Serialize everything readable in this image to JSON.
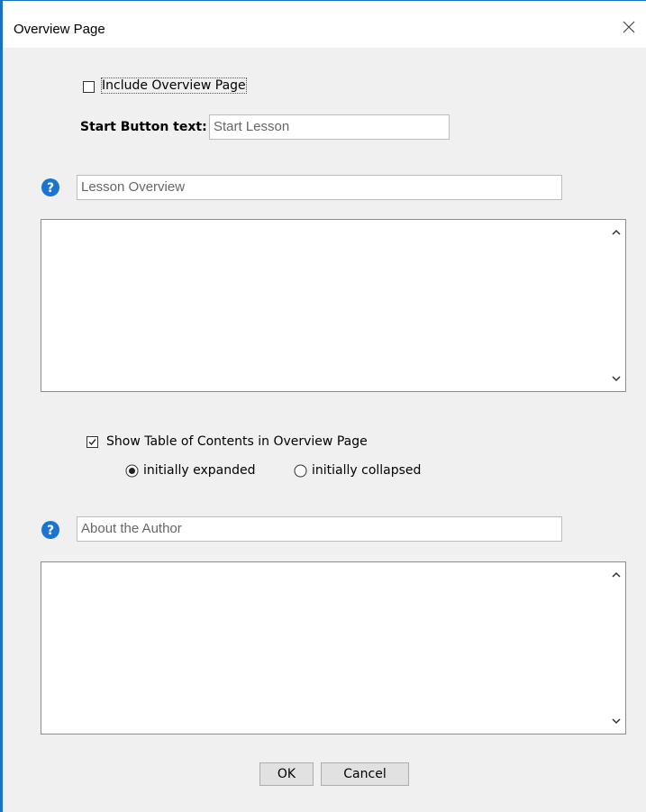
{
  "window": {
    "title": "Overview Page"
  },
  "include_overview": {
    "label": "Include Overview Page",
    "checked": false
  },
  "start_button": {
    "label": "Start Button text:",
    "value": "Start Lesson"
  },
  "lesson_overview": {
    "title_value": "Lesson Overview",
    "body_value": ""
  },
  "toc": {
    "label": "Show Table of Contents in Overview Page",
    "checked": true,
    "options": [
      {
        "label": "initially expanded",
        "selected": true
      },
      {
        "label": "initially collapsed",
        "selected": false
      }
    ]
  },
  "about_author": {
    "title_value": "About the Author",
    "body_value": ""
  },
  "buttons": {
    "ok": "OK",
    "cancel": "Cancel"
  },
  "colors": {
    "accent": "#1c6fc9",
    "help_icon": "#1a75d2",
    "dialog_bg": "#f0f0f0"
  }
}
